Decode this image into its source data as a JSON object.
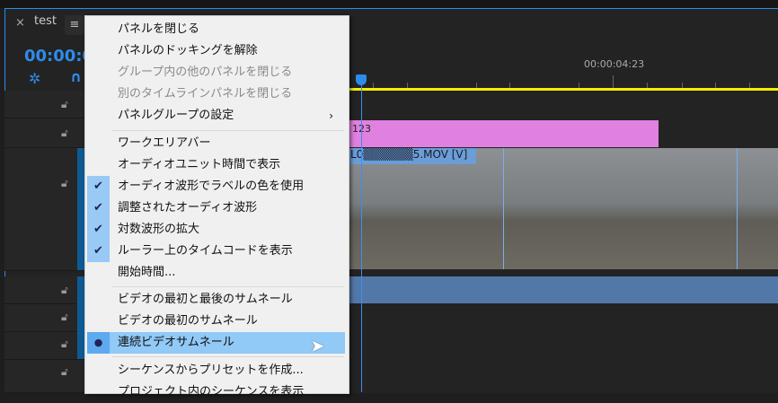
{
  "panel": {
    "tab_title": "test",
    "close": "×",
    "menu": "≡",
    "timecode": "00:00:0",
    "ruler_time": "00:00:04:23"
  },
  "clips": {
    "graphic": "123",
    "video": "L0▒▒▒▒▒▒5.MOV [V]"
  },
  "menu": {
    "items": [
      {
        "label": "パネルを閉じる",
        "enabled": true
      },
      {
        "label": "パネルのドッキングを解除",
        "enabled": true
      },
      {
        "label": "グループ内の他のパネルを閉じる",
        "enabled": false
      },
      {
        "label": "別のタイムラインパネルを閉じる",
        "enabled": false
      },
      {
        "label": "パネルグループの設定",
        "enabled": true,
        "submenu": "›"
      },
      {
        "label": "ワークエリアバー",
        "enabled": true
      },
      {
        "label": "オーディオユニット時間で表示",
        "enabled": true
      },
      {
        "label": "オーディオ波形でラベルの色を使用",
        "checked": true
      },
      {
        "label": "調整されたオーディオ波形",
        "checked": true
      },
      {
        "label": "対数波形の拡大",
        "checked": true
      },
      {
        "label": "ルーラー上のタイムコードを表示",
        "checked": true
      },
      {
        "label": "開始時間...",
        "enabled": true
      },
      {
        "label": "ビデオの最初と最後のサムネール",
        "enabled": true
      },
      {
        "label": "ビデオの最初のサムネール",
        "enabled": true
      },
      {
        "label": "連続ビデオサムネール",
        "selected": true,
        "highlighted": true
      },
      {
        "label": "シーケンスからプリセットを作成...",
        "enabled": true
      },
      {
        "label": "プロジェクト内のシーケンスを表示",
        "enabled": true
      }
    ],
    "check": "✔",
    "bullet": "●"
  }
}
